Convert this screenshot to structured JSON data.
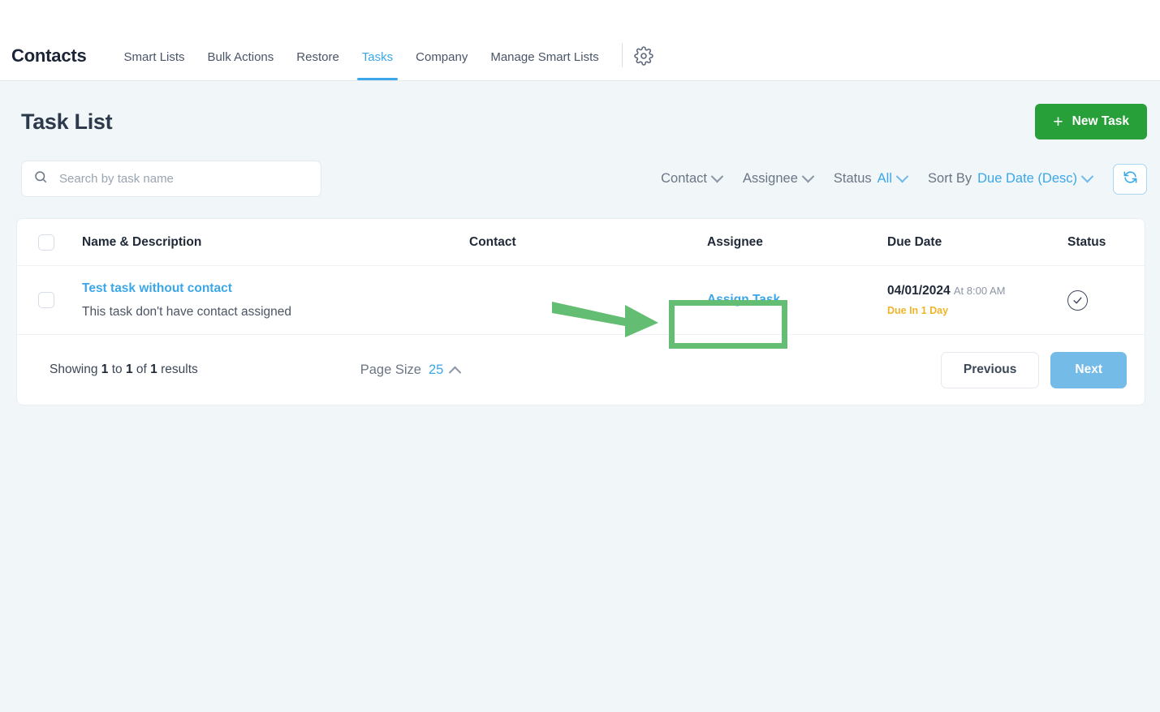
{
  "nav": {
    "brand": "Contacts",
    "items": [
      {
        "label": "Smart Lists",
        "active": false
      },
      {
        "label": "Bulk Actions",
        "active": false
      },
      {
        "label": "Restore",
        "active": false
      },
      {
        "label": "Tasks",
        "active": true
      },
      {
        "label": "Company",
        "active": false
      },
      {
        "label": "Manage Smart Lists",
        "active": false
      }
    ],
    "settings_icon": "gear-icon"
  },
  "header": {
    "title": "Task List",
    "new_task_label": "New Task",
    "new_task_icon": "plus-icon",
    "new_task_color": "#28a03a"
  },
  "search": {
    "placeholder": "Search by task name",
    "value": "",
    "icon": "search-icon"
  },
  "filters": {
    "contact_label": "Contact",
    "assignee_label": "Assignee",
    "status_label": "Status",
    "status_value": "All",
    "sort_label": "Sort By",
    "sort_value": "Due Date (Desc)",
    "refresh_icon": "refresh-icon",
    "accent_color": "#3ba7e8"
  },
  "table": {
    "columns": [
      "Name & Description",
      "Contact",
      "Assignee",
      "Due Date",
      "Status"
    ],
    "rows": [
      {
        "name": "Test task without contact",
        "description": "This task don't have contact assigned",
        "contact": "",
        "assignee": "Assign Task",
        "due_date": "04/01/2024",
        "due_time": "At 8:00 AM",
        "due_note": "Due In 1 Day",
        "due_note_color": "#f0b429",
        "status_icon": "check-circle-icon",
        "menu_icon": "ellipsis-icon"
      }
    ]
  },
  "footer": {
    "showing_prefix": "Showing",
    "showing_from": "1",
    "showing_to_word": "to",
    "showing_to": "1",
    "showing_of_word": "of",
    "showing_total": "1",
    "showing_suffix": "results",
    "page_size_label": "Page Size",
    "page_size_value": "25",
    "previous_label": "Previous",
    "next_label": "Next"
  },
  "annotation": {
    "highlight_color": "#63bd72",
    "target": "Assign Task"
  }
}
